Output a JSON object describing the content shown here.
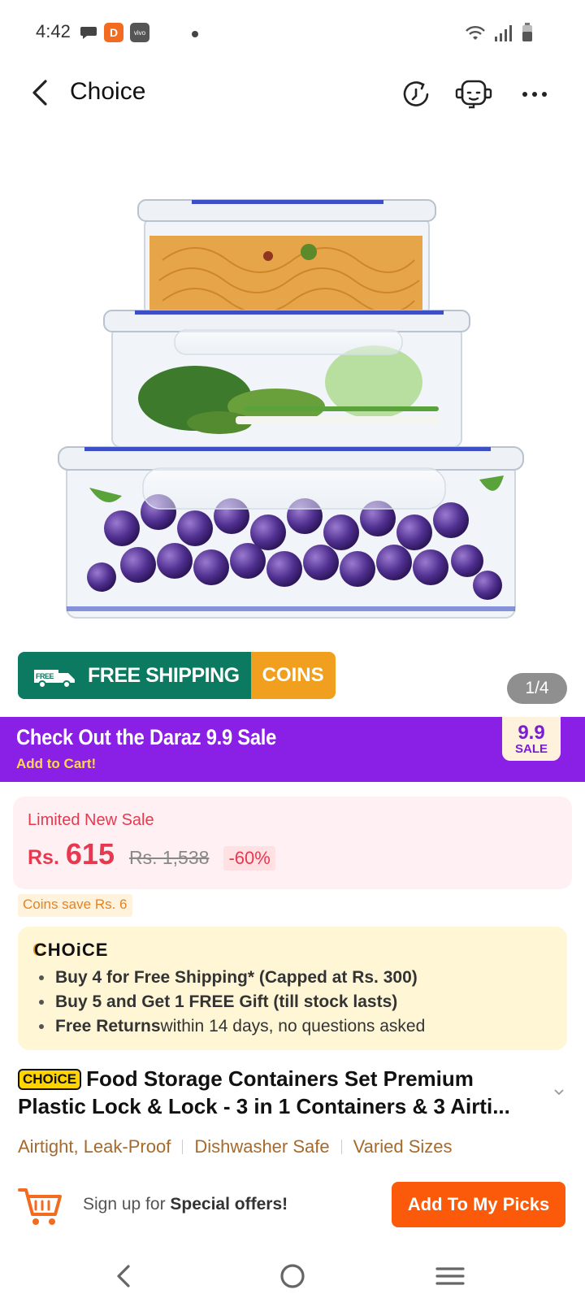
{
  "status_bar": {
    "time": "4:42",
    "app_icon_1": "D",
    "app_icon_2": "vivo"
  },
  "header": {
    "title": "Choice"
  },
  "hero": {
    "free_label": "FREE",
    "free_shipping": "FREE SHIPPING",
    "coins": "COINS",
    "image_counter": "1/4",
    "colors": {
      "shipping_green": "#0c7a60",
      "coins_orange": "#f0a01e"
    }
  },
  "promo": {
    "title": "Check Out the  Daraz 9.9 Sale",
    "subtitle": "Add to Cart!",
    "badge_number": "9.9",
    "badge_label": "SALE",
    "color": "#8a1fe6"
  },
  "price": {
    "label": "Limited New Sale",
    "currency": "Rs.",
    "value": "615",
    "original": "Rs. 1,538",
    "discount": "-60%"
  },
  "coins_save": "Coins save Rs. 6",
  "choice": {
    "logo": "CHOiCE",
    "items": [
      {
        "bold": "Buy 4 for  Free Shipping* (Capped at Rs. 300)",
        "rest": ""
      },
      {
        "bold": "Buy 5 and Get 1 FREE Gift (till stock lasts)",
        "rest": ""
      },
      {
        "bold": "Free Returns",
        "rest": " within 14 days, no questions asked"
      }
    ]
  },
  "product": {
    "tag": "CHOiCE",
    "title": "Food  Storage Containers Set Premium Plastic Lock & Lock - 3 in 1 Containers & 3 Airti..."
  },
  "features": [
    "Airtight, Leak-Proof",
    "Dishwasher Safe",
    "Varied Sizes"
  ],
  "action_bar": {
    "signup_prefix": "Sign up for ",
    "signup_bold": "Special offers!",
    "picks_button": "Add To My Picks",
    "accent": "#fa5a0a"
  },
  "icons": [
    "back-arrow-icon",
    "share-icon",
    "support-icon",
    "more-icon",
    "cart-icon",
    "chevron-down-icon",
    "nav-back-icon",
    "nav-home-icon",
    "nav-menu-icon"
  ]
}
